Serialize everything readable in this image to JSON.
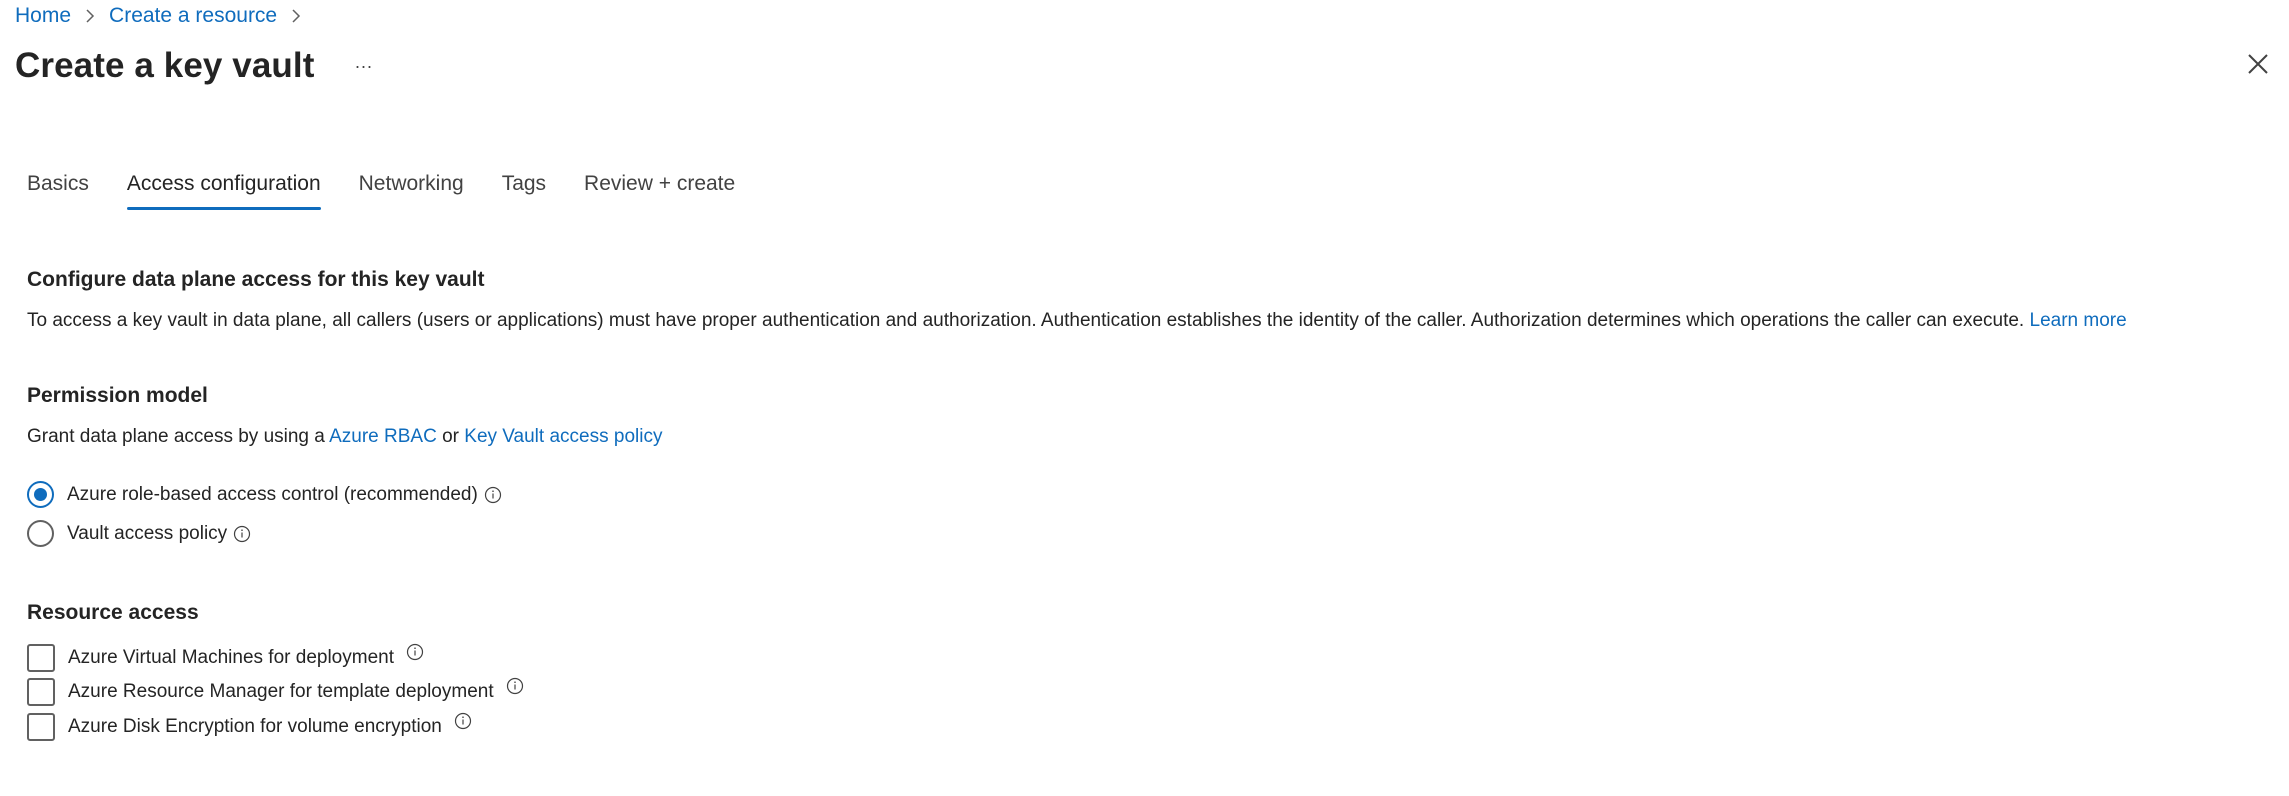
{
  "breadcrumb": {
    "items": [
      "Home",
      "Create a resource"
    ]
  },
  "page": {
    "title": "Create a key vault",
    "more_label": "···"
  },
  "tabs": [
    {
      "label": "Basics",
      "active": false
    },
    {
      "label": "Access configuration",
      "active": true
    },
    {
      "label": "Networking",
      "active": false
    },
    {
      "label": "Tags",
      "active": false
    },
    {
      "label": "Review + create",
      "active": false
    }
  ],
  "data_plane": {
    "heading": "Configure data plane access for this key vault",
    "description": "To access a key vault in data plane, all callers (users or applications) must have proper authentication and authorization. Authentication establishes the identity of the caller. Authorization determines which operations the caller can execute.",
    "learn_more": "Learn more"
  },
  "permission_model": {
    "heading": "Permission model",
    "grant_prefix": "Grant data plane access by using a",
    "rbac_link": "Azure RBAC",
    "or_text": "or",
    "policy_link": "Key Vault access policy",
    "options": [
      {
        "label": "Azure role-based access control (recommended)",
        "checked": true
      },
      {
        "label": "Vault access policy",
        "checked": false
      }
    ]
  },
  "resource_access": {
    "heading": "Resource access",
    "options": [
      {
        "label": "Azure Virtual Machines for deployment",
        "checked": false
      },
      {
        "label": "Azure Resource Manager for template deployment",
        "checked": false
      },
      {
        "label": "Azure Disk Encryption for volume encryption",
        "checked": false
      }
    ]
  },
  "colors": {
    "accent": "#0f6cbd",
    "text": "#242424",
    "border": "#616161"
  }
}
